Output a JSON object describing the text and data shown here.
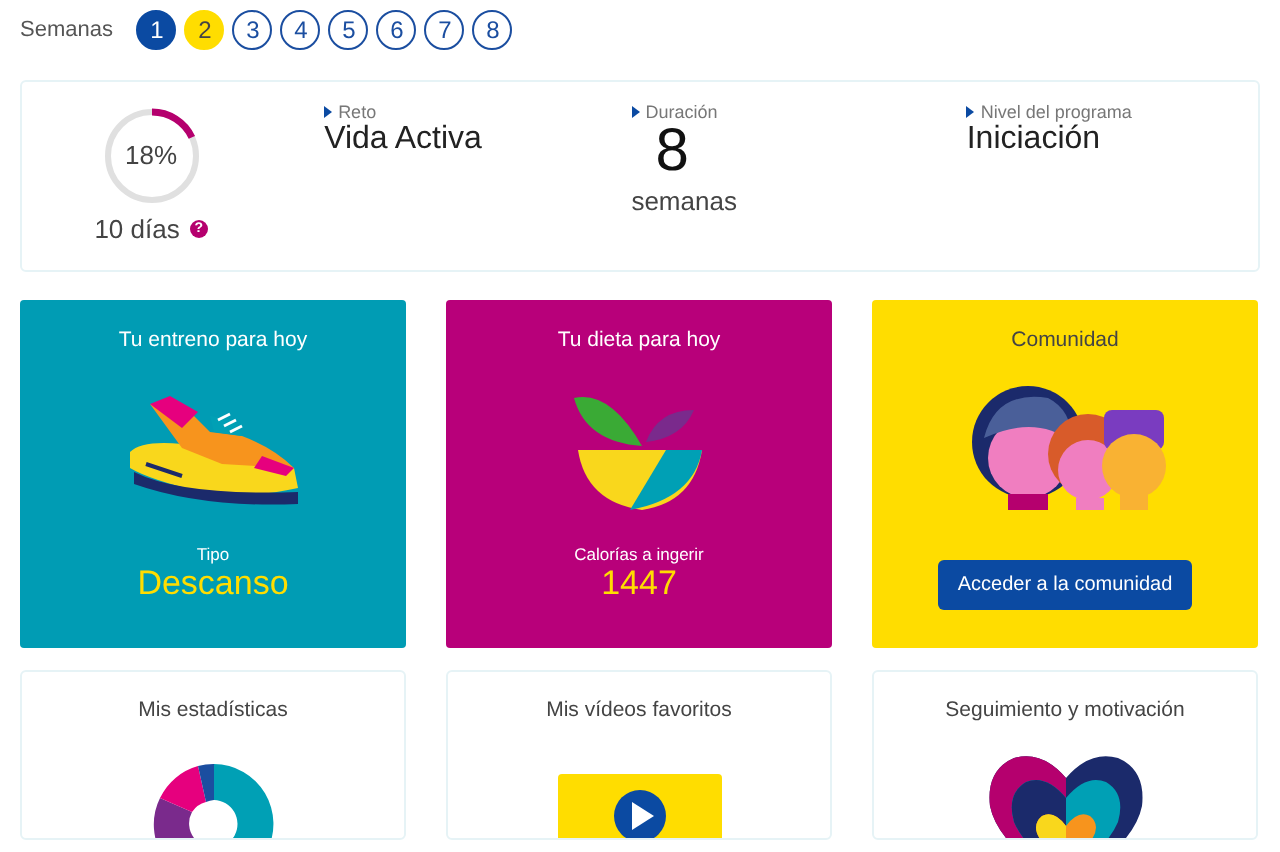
{
  "weeks": {
    "label": "Semanas",
    "items": [
      {
        "number": "1",
        "kind": "done"
      },
      {
        "number": "2",
        "kind": "current"
      },
      {
        "number": "3",
        "kind": "upcoming"
      },
      {
        "number": "4",
        "kind": "upcoming"
      },
      {
        "number": "5",
        "kind": "upcoming"
      },
      {
        "number": "6",
        "kind": "upcoming"
      },
      {
        "number": "7",
        "kind": "upcoming"
      },
      {
        "number": "8",
        "kind": "upcoming"
      }
    ]
  },
  "summary": {
    "progress": {
      "level": 0.18,
      "reading": "18%",
      "days": "10 días",
      "help": "?"
    },
    "facts": [
      {
        "label": "Reto",
        "value": "Vida Activa",
        "kind": "text"
      },
      {
        "label": "Duración",
        "value": "8",
        "unit": "semanas",
        "kind": "number"
      },
      {
        "label": "Nivel del programa",
        "value": "Iniciación",
        "kind": "text"
      }
    ]
  },
  "tiles": [
    {
      "kind": "workout",
      "title": "Tu entreno para hoy",
      "caption": "Tipo",
      "value": "Descanso"
    },
    {
      "kind": "diet",
      "title": "Tu dieta para hoy",
      "caption": "Calorías a ingerir",
      "value": "1447"
    },
    {
      "kind": "community",
      "title": "Comunidad",
      "button": "Acceder a la comunidad"
    }
  ],
  "cards": [
    {
      "kind": "stats",
      "title": "Mis estadísticas"
    },
    {
      "kind": "videos",
      "title": "Mis vídeos favoritos"
    },
    {
      "kind": "motivation",
      "title": "Seguimiento y motivación"
    }
  ]
}
